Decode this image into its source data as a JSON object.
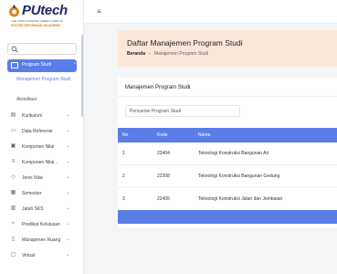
{
  "brand": {
    "name": "PUtech",
    "tagline": "THE FIRST PRIVATE GREEN CAMPUS",
    "subtitle": "SISTEM INFORMASI AKADEMIK"
  },
  "sidebar": {
    "active": {
      "label": "Program Studi"
    },
    "subitems": [
      {
        "label": "Manajemen Program Studi"
      },
      {
        "label": "Akreditasi"
      }
    ],
    "items": [
      {
        "label": "Kurikulum",
        "icon": "book-icon"
      },
      {
        "label": "Data Referensi",
        "icon": "folder-icon"
      },
      {
        "label": "Komponen Nilai",
        "icon": "clipboard-icon"
      },
      {
        "label": "Komponen Nilai...",
        "icon": "list-icon"
      },
      {
        "label": "Jenis Nilai",
        "icon": "tag-icon"
      },
      {
        "label": "Semester",
        "icon": "calendar-icon"
      },
      {
        "label": "Jatah SKS",
        "icon": "chart-icon"
      },
      {
        "label": "Predikat Kelulusan",
        "icon": "award-icon"
      },
      {
        "label": "Manajemen Ruang",
        "icon": "building-icon"
      },
      {
        "label": "Virtual",
        "icon": "monitor-icon"
      }
    ]
  },
  "header": {
    "title": "Daftar Manajemen Program Studi",
    "breadcrumb": {
      "home": "Beranda",
      "current": "Manajemen Program Studi"
    }
  },
  "card": {
    "title": "Manajemen Program Studi",
    "search_value": "Pencarian Program Studi"
  },
  "table": {
    "columns": [
      "No",
      "Kode",
      "Nama"
    ],
    "rows": [
      {
        "no": "1",
        "kode": "22404",
        "nama": "Teknologi Konstruksi Bangunan Air"
      },
      {
        "no": "2",
        "kode": "22308",
        "nama": "Teknologi Konstruksi Bangunan Gedung"
      },
      {
        "no": "3",
        "kode": "22405",
        "nama": "Teknologi Konstruksi Jalan dan Jembatan"
      }
    ]
  },
  "colors": {
    "accent": "#5b7de8",
    "header_bg": "#fbe7d9",
    "brand_navy": "#1f2a6b",
    "brand_orange": "#d9861c"
  }
}
